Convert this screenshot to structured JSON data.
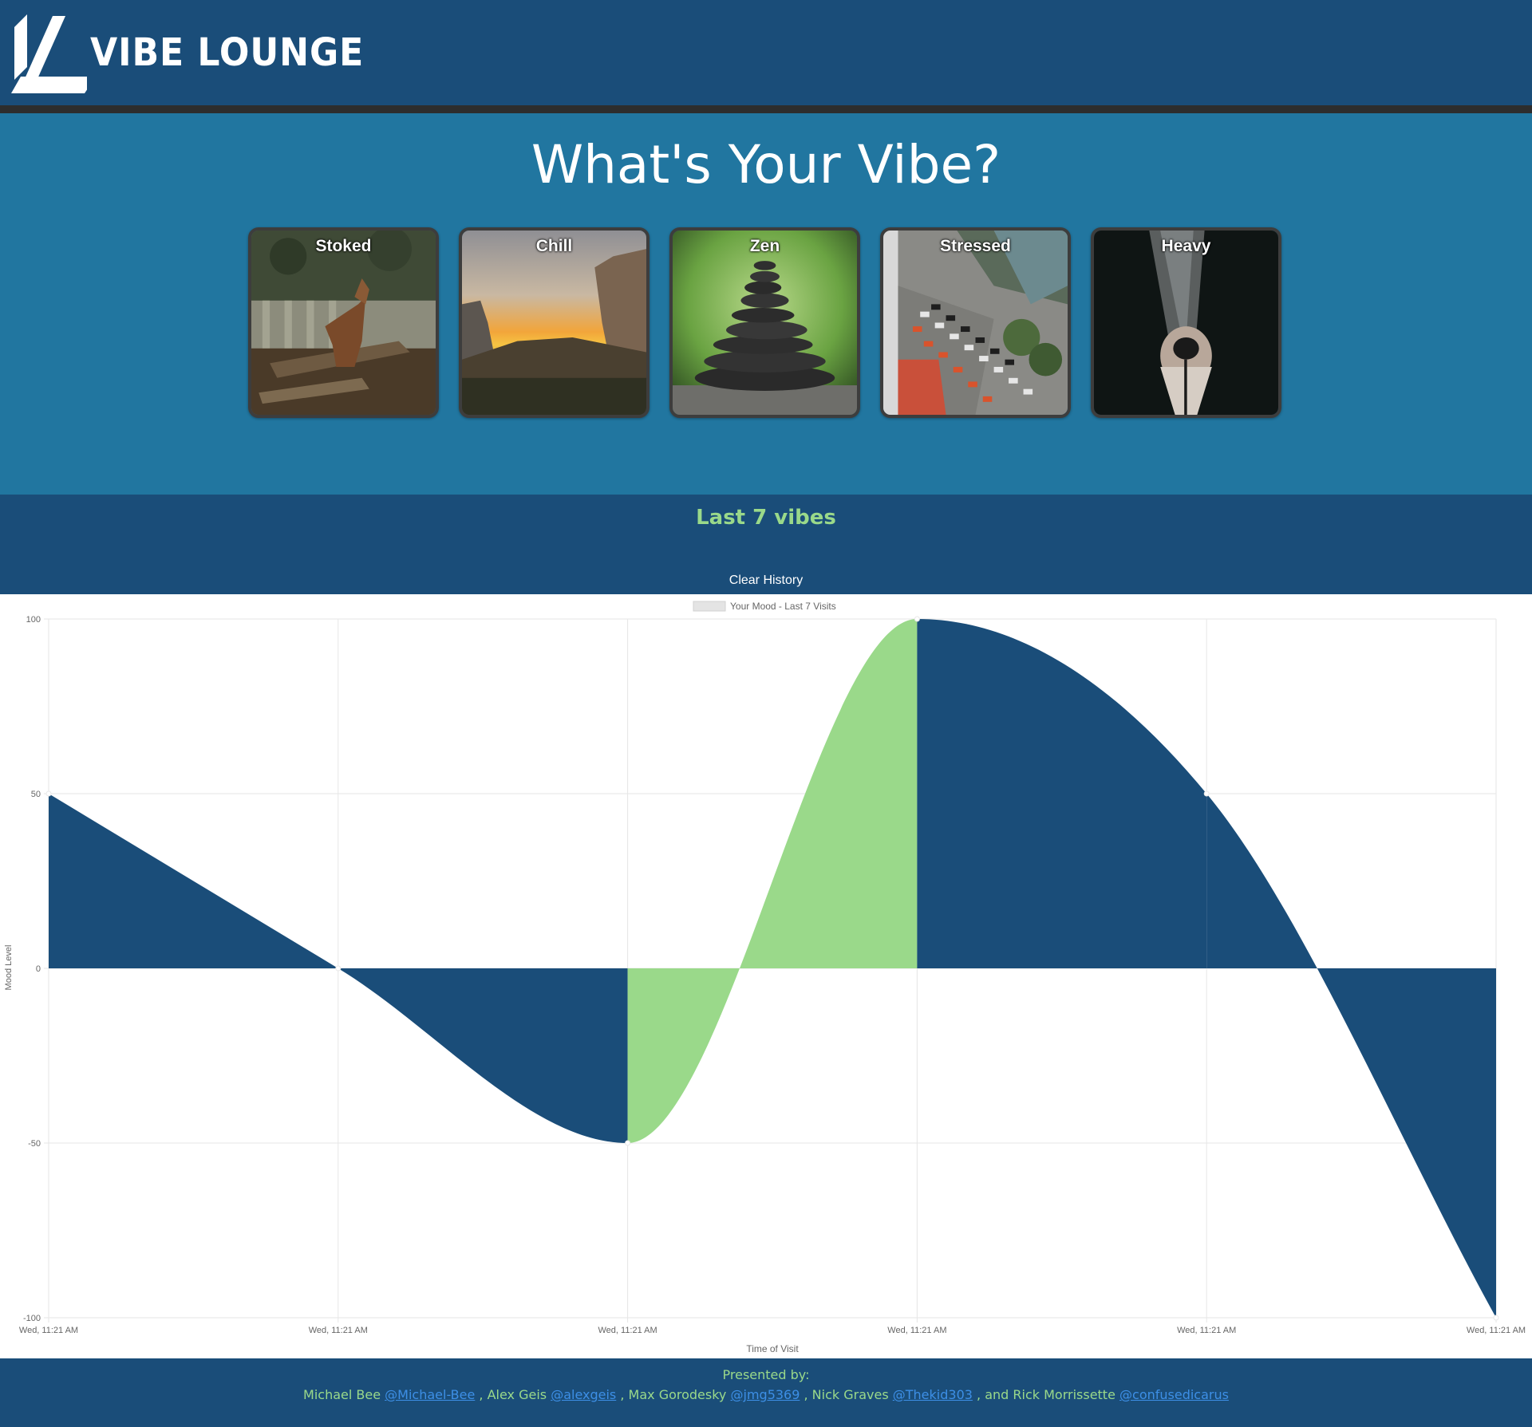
{
  "brand": {
    "name": "VIBE LOUNGE",
    "logo_icon": "vl-monogram-icon",
    "colors": {
      "navy": "#1a4d79",
      "teal": "#2176a0",
      "green": "#9ad98a",
      "link": "#3d8fe6"
    }
  },
  "hero": {
    "title": "What's Your Vibe?",
    "moods": [
      {
        "label": "Stoked",
        "image": "howling-wolf-photo"
      },
      {
        "label": "Chill",
        "image": "sunset-valley-photo"
      },
      {
        "label": "Zen",
        "image": "stacked-stones-photo"
      },
      {
        "label": "Stressed",
        "image": "city-traffic-photo"
      },
      {
        "label": "Heavy",
        "image": "hooded-figure-photo"
      }
    ]
  },
  "history": {
    "title": "Last 7 vibes",
    "clear_label": "Clear History"
  },
  "chart_data": {
    "type": "line",
    "fill": "origin",
    "legend": {
      "label": "Your Mood - Last 7 Visits",
      "position": "top"
    },
    "xlabel": "Time of Visit",
    "ylabel": "Mood Level",
    "ylim": [
      -100,
      100
    ],
    "y_ticks": [
      "100",
      "50",
      "0",
      "-50",
      "-100"
    ],
    "grid": true,
    "categories": [
      "Wed, 11:21 AM",
      "Wed, 11:21 AM",
      "Wed, 11:21 AM",
      "Wed, 11:21 AM",
      "Wed, 11:21 AM",
      "Wed, 11:21 AM"
    ],
    "series": [
      {
        "name": "Your Mood - Last 7 Visits",
        "values": [
          50,
          0,
          -50,
          100,
          50,
          -100
        ]
      }
    ],
    "segment_colors": [
      "#1a4d79",
      "#1a4d79",
      "#9ad98a",
      "#1a4d79",
      "#1a4d79"
    ]
  },
  "footer": {
    "heading": "Presented by:",
    "credits": [
      {
        "name": "Michael Bee",
        "handle": "@Michael-Bee",
        "sep": " ,"
      },
      {
        "name": "Alex Geis",
        "handle": "@alexgeis",
        "sep": " ,"
      },
      {
        "name": "Max Gorodesky",
        "handle": "@jmg5369",
        "sep": " ,"
      },
      {
        "name": "Nick Graves",
        "handle": "@Thekid303",
        "sep": " , and"
      },
      {
        "name": "Rick Morrissette",
        "handle": "@confusedicarus",
        "sep": ""
      }
    ]
  }
}
